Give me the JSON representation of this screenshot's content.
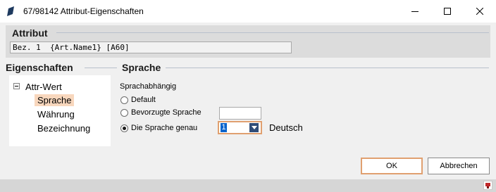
{
  "window": {
    "title": "67/98142 Attribut-Eigenschaften",
    "icons": {
      "app": "app-icon",
      "minimize": "minimize-icon",
      "maximize": "maximize-icon",
      "close": "close-icon"
    }
  },
  "attribut": {
    "header": "Attribut",
    "value": "Bez. 1  {Art.Name1} [A60]"
  },
  "eigenschaften": {
    "header": "Eigenschaften",
    "tree_root": "Attr-Wert",
    "items": [
      {
        "label": "Sprache",
        "selected": true
      },
      {
        "label": "Währung",
        "selected": false
      },
      {
        "label": "Bezeichnung",
        "selected": false
      }
    ]
  },
  "sprache": {
    "header": "Sprache",
    "sublabel": "Sprachabhängig",
    "options": [
      {
        "label": "Default",
        "selected": false
      },
      {
        "label": "Bevorzugte Sprache",
        "selected": false
      },
      {
        "label": "Die Sprache genau",
        "selected": true
      }
    ],
    "combo_value": "1",
    "language_name": "Deutsch"
  },
  "buttons": {
    "ok": "OK",
    "cancel": "Abbrechen"
  },
  "colors": {
    "accent": "#e0a070",
    "selection": "#f8d7bd",
    "combo_selection": "#0a64cc",
    "section_line": "#b8c0cc"
  }
}
